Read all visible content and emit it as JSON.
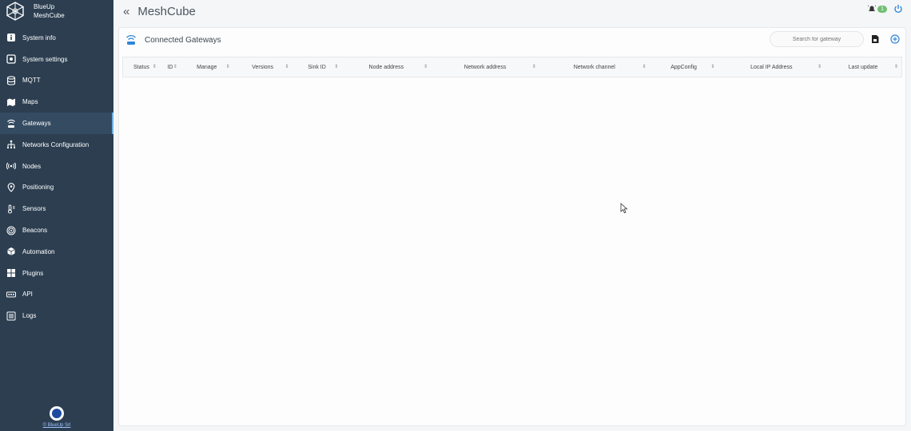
{
  "brand": {
    "line1": "BlueUp",
    "line2": "MeshCube",
    "logo_icon": "hexagon-mesh-icon"
  },
  "topbar": {
    "collapse_label": "«",
    "title": "MeshCube",
    "notification_count": "1",
    "accent": "#6fbf73"
  },
  "sidebar": {
    "items": [
      {
        "label": "System info",
        "icon": "info-icon",
        "active": false
      },
      {
        "label": "System settings",
        "icon": "settings-icon",
        "active": false
      },
      {
        "label": "MQTT",
        "icon": "database-icon",
        "active": false
      },
      {
        "label": "Maps",
        "icon": "map-icon",
        "active": false
      },
      {
        "label": "Gateways",
        "icon": "gateway-icon",
        "active": true
      },
      {
        "label": "Networks Configuration",
        "icon": "network-tree-icon",
        "active": false
      },
      {
        "label": "Nodes",
        "icon": "broadcast-icon",
        "active": false
      },
      {
        "label": "Positioning",
        "icon": "location-pin-icon",
        "active": false
      },
      {
        "label": "Sensors",
        "icon": "thermometer-icon",
        "active": false
      },
      {
        "label": "Beacons",
        "icon": "beacon-icon",
        "active": false
      },
      {
        "label": "Automation",
        "icon": "cube-icon",
        "active": false
      },
      {
        "label": "Plugins",
        "icon": "plugins-icon",
        "active": false
      },
      {
        "label": "API",
        "icon": "api-icon",
        "active": false
      },
      {
        "label": "Logs",
        "icon": "logs-icon",
        "active": false
      }
    ],
    "footer_link": "© BlueUp Srl"
  },
  "main": {
    "title": "Connected Gateways",
    "search_placeholder": "Search for gateway",
    "columns": [
      "Status",
      "ID",
      "Manage",
      "Versions",
      "Sink ID",
      "Node address",
      "Network address",
      "Network channel",
      "AppConfig",
      "Local IP Address",
      "Last update"
    ],
    "rows": []
  }
}
